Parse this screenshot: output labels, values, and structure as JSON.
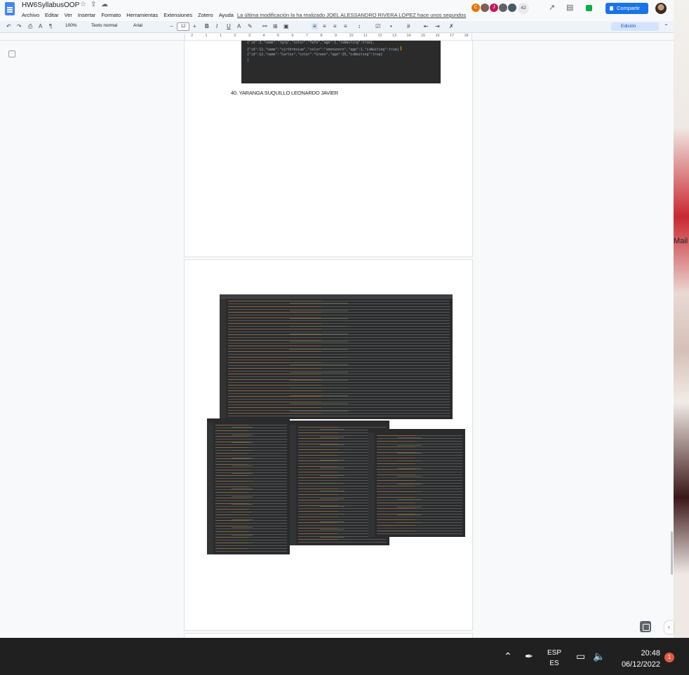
{
  "document": {
    "title": "HW6SyllabusOOP",
    "last_edit": "La última modificación la ha realizado JOEL ALESSANDRO RIVERA LOPEZ hace unos segundos"
  },
  "menu": [
    "Archivo",
    "Editar",
    "Ver",
    "Insertar",
    "Formato",
    "Herramientas",
    "Extensiones",
    "Zotero",
    "Ayuda"
  ],
  "collaborators": {
    "count_label": "42",
    "avatars": [
      {
        "initial": "C",
        "color": "#e37400"
      },
      {
        "initial": "",
        "color": "#7b5e57"
      },
      {
        "initial": "J",
        "color": "#c2185b"
      },
      {
        "initial": "",
        "color": "#5f6368"
      },
      {
        "initial": "",
        "color": "#455a64"
      }
    ]
  },
  "share_label": "Compartir",
  "toolbar": {
    "zoom": "100%",
    "style": "Texto normal",
    "font": "Arial",
    "font_size": "12",
    "mode": "Edición"
  },
  "ruler_numbers": [
    "2",
    "1",
    "1",
    "2",
    "3",
    "4",
    "5",
    "6",
    "7",
    "8",
    "9",
    "10",
    "11",
    "12",
    "13",
    "14",
    "15",
    "16",
    "17",
    "18"
  ],
  "code_snippet": [
    "{\"id\":3,\"name\":\"rgrg\",\"color\":\"fefe\",\"age\":1,\"isWaiting\":true},",
    "{\"id\":12,\"name\":\"sjrthrbsiue\",\"color\":\"vmnnvnnrn\",\"age\":1,\"isWaiting\":true}",
    "{\"id\":12,\"name\":\"Carlos\",\"color\":\"Green\",\"age\":35,\"isWaiting\":true}",
    "]"
  ],
  "section_heading": "40. YARANGA SUQUILLO LEONARDO JAVIER",
  "wallpaper_text": "Mail",
  "taskbar": {
    "lang_top": "ESP",
    "lang_bottom": "ES",
    "time": "20:48",
    "date": "06/12/2022",
    "notifications": "1"
  },
  "colors": {
    "share_blue": "#1a73e8",
    "code_bg": "#2b2b2b",
    "taskbar_bg": "#202020"
  }
}
